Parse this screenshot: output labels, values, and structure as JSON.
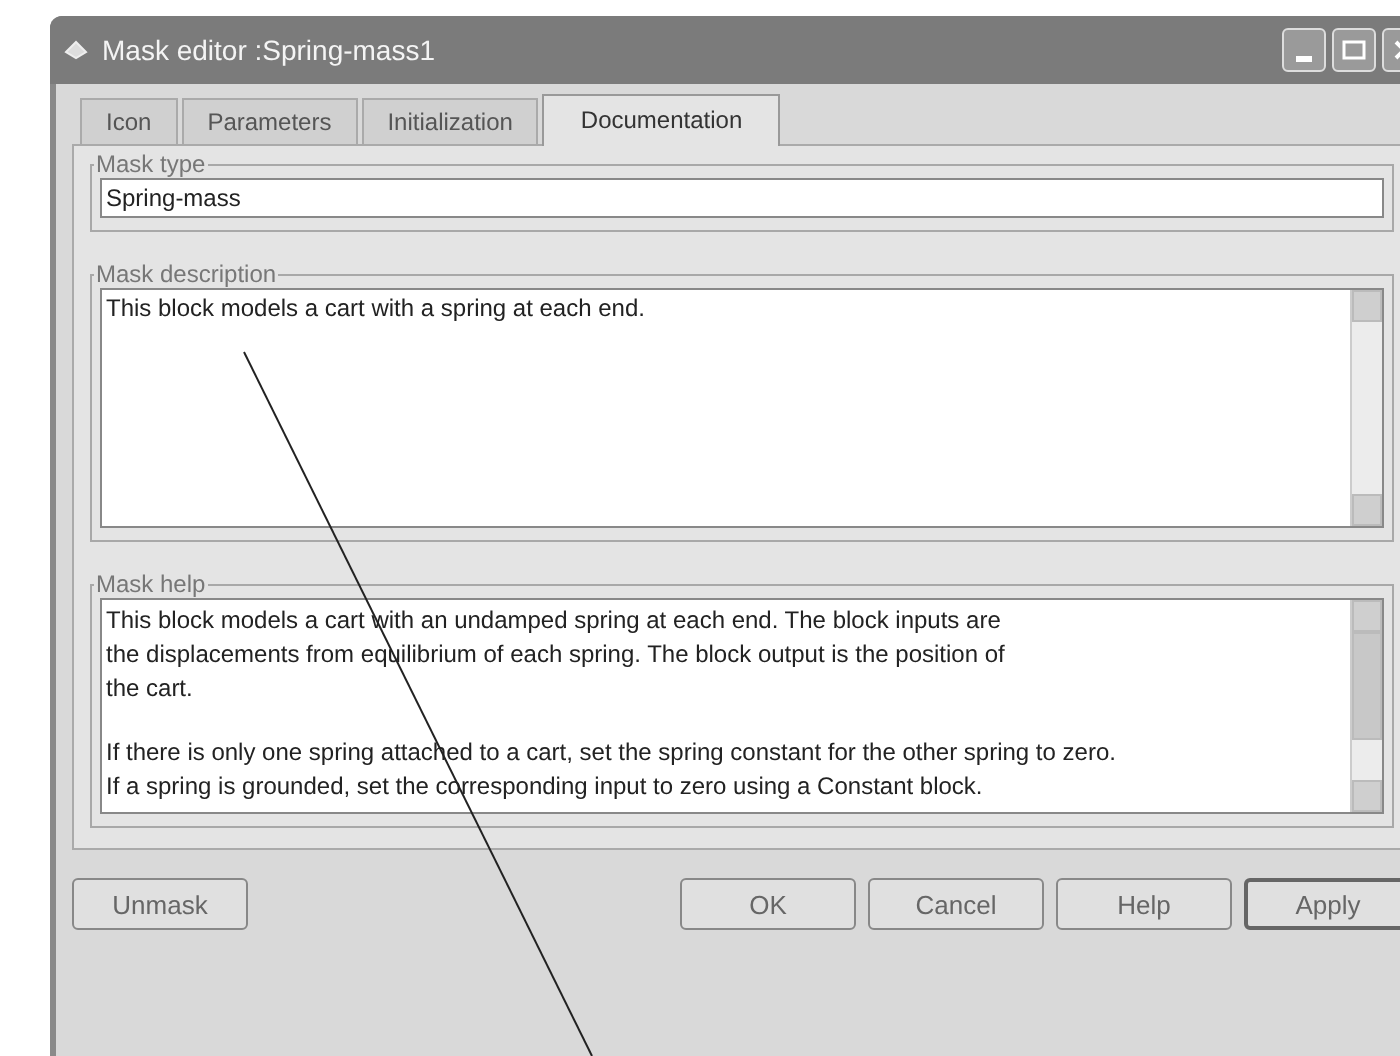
{
  "window": {
    "title": "Mask editor :Spring-mass1"
  },
  "tabs": [
    {
      "label": "Icon",
      "selected": false
    },
    {
      "label": "Parameters",
      "selected": false
    },
    {
      "label": "Initialization",
      "selected": false
    },
    {
      "label": "Documentation",
      "selected": true
    }
  ],
  "mask_type": {
    "label": "Mask type",
    "value": "Spring-mass"
  },
  "mask_description": {
    "label": "Mask description",
    "value": "This block models a cart with a spring at each end."
  },
  "mask_help": {
    "label": "Mask help",
    "paragraphs": [
      "This block models a cart with an undamped spring at each end. The block inputs are\nthe displacements from equilibrium of each spring. The block output is the position of\nthe cart.",
      "If there is only one spring attached to a cart, set  the spring constant for the other spring to zero.\nIf a spring is grounded, set the corresponding input to zero using a Constant block."
    ]
  },
  "buttons_left": [
    {
      "label": "Unmask",
      "default": false
    }
  ],
  "buttons_right": [
    {
      "label": "OK",
      "default": false
    },
    {
      "label": "Cancel",
      "default": false
    },
    {
      "label": "Help",
      "default": false
    },
    {
      "label": "Apply",
      "default": true
    }
  ]
}
